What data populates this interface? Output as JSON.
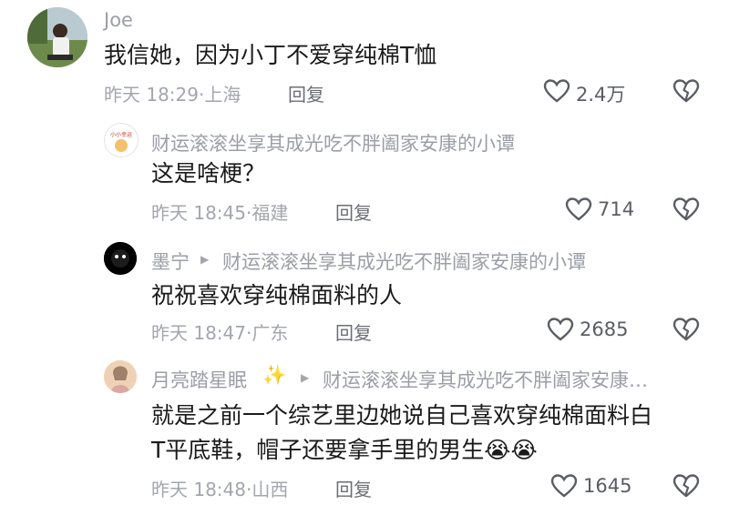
{
  "comments": [
    {
      "author": "Joe",
      "text": "我信她，因为小丁不爱穿纯棉T恤",
      "time": "昨天 18:29·上海",
      "reply_label": "回复",
      "likes": "2.4万"
    },
    {
      "author": "财运滚滚坐享其成光吃不胖阖家安康的小谭",
      "text": "这是啥梗？",
      "time": "昨天 18:45·福建",
      "reply_label": "回复",
      "likes": "714"
    },
    {
      "author": "墨宁",
      "reply_to": "财运滚滚坐享其成光吃不胖阖家安康的小谭",
      "text": "祝祝喜欢穿纯棉面料的人",
      "time": "昨天 18:47·广东",
      "reply_label": "回复",
      "likes": "2685"
    },
    {
      "author": "月亮踏星眠",
      "author_emoji": "✨",
      "reply_to": "财运滚滚坐享其成光吃不胖阖家安康…",
      "text_line1": "就是之前一个综艺里边她说自己喜欢穿纯棉面料白",
      "text_line2": "T平底鞋，帽子还要拿手里的男生",
      "text_emoji": "😭😭",
      "time": "昨天 18:48·山西",
      "reply_label": "回复",
      "likes": "1645"
    }
  ],
  "avatar2_text": "小小幸运"
}
